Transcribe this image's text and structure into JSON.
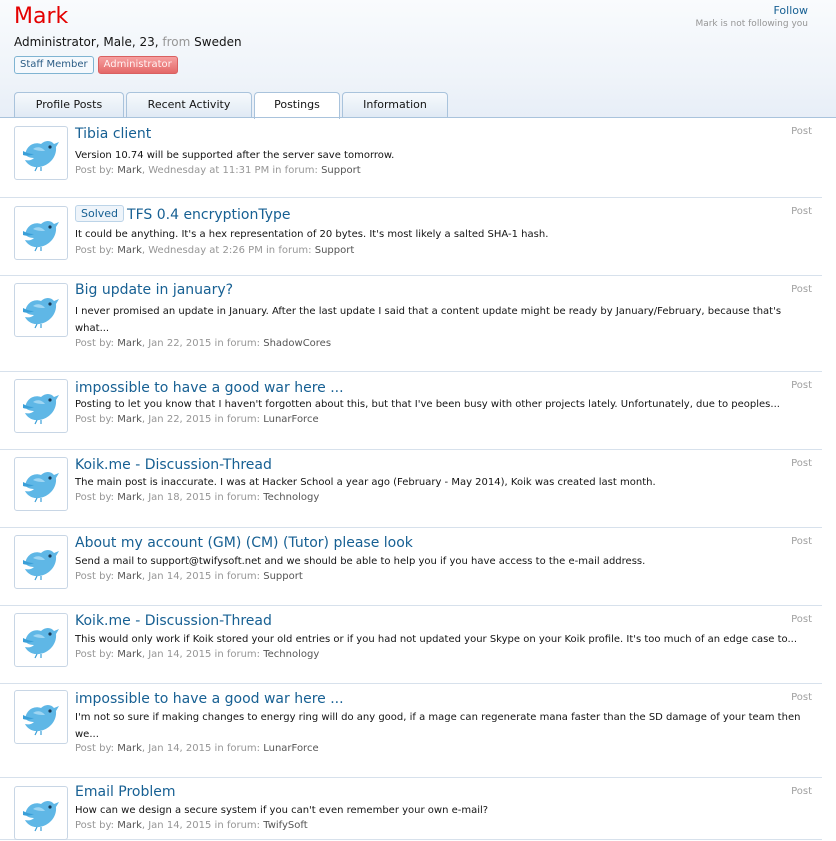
{
  "profile": {
    "name": "Mark",
    "info": "Administrator, Male, 23,",
    "from_label": "from",
    "location": "Sweden",
    "banners": [
      "Staff Member",
      "Administrator"
    ],
    "follow_label": "Follow",
    "following_status": "Mark is not following you"
  },
  "tabs": [
    {
      "label": "Profile Posts",
      "active": false
    },
    {
      "label": "Recent Activity",
      "active": false
    },
    {
      "label": "Postings",
      "active": true
    },
    {
      "label": "Information",
      "active": false
    }
  ],
  "colors": {
    "username": "#e40000",
    "link": "#176093",
    "muted": "#969696",
    "header_bg": "#eef3f9"
  },
  "avatar_icon": "twitter-bird-icon",
  "posts": [
    {
      "title": "Tibia client",
      "prefix": "",
      "snippet": "Version 10.74 will be supported after the server save tomorrow.",
      "by_label": "Post by:",
      "author": "Mark",
      "date": "Wednesday at 11:31 PM",
      "in_forum_label": "in forum:",
      "forum": "Support",
      "type": "Post"
    },
    {
      "title": "TFS 0.4 encryptionType",
      "prefix": "Solved",
      "snippet": "It could be anything. It's a hex representation of 20 bytes. It's most likely a salted SHA-1 hash.",
      "by_label": "Post by:",
      "author": "Mark",
      "date": "Wednesday at 2:26 PM",
      "in_forum_label": "in forum:",
      "forum": "Support",
      "type": "Post"
    },
    {
      "title": "Big update in january?",
      "prefix": "",
      "snippet": "I never promised an update in January. After the last update I said that a content update might be ready by January/February, because that's what...",
      "by_label": "Post by:",
      "author": "Mark",
      "date": "Jan 22, 2015",
      "in_forum_label": "in forum:",
      "forum": "ShadowCores",
      "type": "Post"
    },
    {
      "title": "impossible to have a good war here ...",
      "prefix": "",
      "snippet": "Posting to let you know that I haven't forgotten about this, but that I've been busy with other projects lately. Unfortunately, due to peoples...",
      "by_label": "Post by:",
      "author": "Mark",
      "date": "Jan 22, 2015",
      "in_forum_label": "in forum:",
      "forum": "LunarForce",
      "type": "Post"
    },
    {
      "title": "Koik.me - Discussion-Thread",
      "prefix": "",
      "snippet": "The main post is inaccurate. I was at Hacker School a year ago (February - May 2014), Koik was created last month.",
      "by_label": "Post by:",
      "author": "Mark",
      "date": "Jan 18, 2015",
      "in_forum_label": "in forum:",
      "forum": "Technology",
      "type": "Post"
    },
    {
      "title": "About my account (GM) (CM) (Tutor) please look",
      "prefix": "",
      "snippet": "Send a mail to support@twifysoft.net and we should be able to help you if you have access to the e-mail address.",
      "by_label": "Post by:",
      "author": "Mark",
      "date": "Jan 14, 2015",
      "in_forum_label": "in forum:",
      "forum": "Support",
      "type": "Post"
    },
    {
      "title": "Koik.me - Discussion-Thread",
      "prefix": "",
      "snippet": "This would only work if Koik stored your old entries or if you had not updated your Skype on your Koik profile. It's too much of an edge case to...",
      "by_label": "Post by:",
      "author": "Mark",
      "date": "Jan 14, 2015",
      "in_forum_label": "in forum:",
      "forum": "Technology",
      "type": "Post"
    },
    {
      "title": "impossible to have a good war here ...",
      "prefix": "",
      "snippet": "I'm not so sure if making changes to energy ring will do any good, if a mage can regenerate mana faster than the SD damage of your team then we...",
      "by_label": "Post by:",
      "author": "Mark",
      "date": "Jan 14, 2015",
      "in_forum_label": "in forum:",
      "forum": "LunarForce",
      "type": "Post"
    },
    {
      "title": "Email Problem",
      "prefix": "",
      "snippet": "How can we design a secure system if you can't even remember your own e-mail?",
      "by_label": "Post by:",
      "author": "Mark",
      "date": "Jan 14, 2015",
      "in_forum_label": "in forum:",
      "forum": "TwifySoft",
      "type": "Post"
    }
  ]
}
